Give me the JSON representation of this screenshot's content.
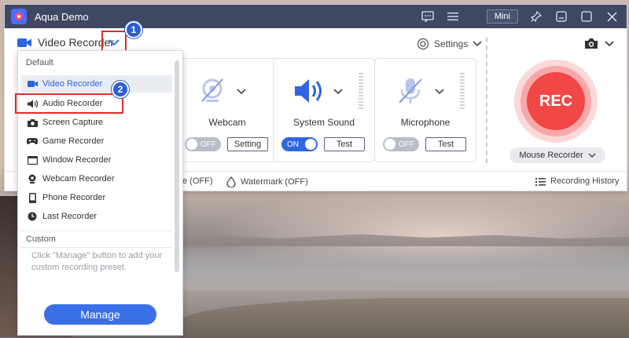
{
  "window": {
    "app_title": "Aqua Demo",
    "mini_label": "Mini"
  },
  "annotations": {
    "badge_1": "1",
    "badge_2": "2"
  },
  "mode": {
    "current_label": "Video Recorder"
  },
  "settings": {
    "label": "Settings"
  },
  "tiles": {
    "webcam": {
      "name": "Webcam",
      "toggle": "OFF",
      "button": "Setting"
    },
    "system_sound": {
      "name": "System Sound",
      "toggle": "ON",
      "button": "Test"
    },
    "microphone": {
      "name": "Microphone",
      "toggle": "OFF",
      "button": "Test"
    }
  },
  "rec": {
    "label": "REC",
    "mouse_recorder": "Mouse Recorder"
  },
  "bottom_bar": {
    "partial_label": "e (OFF)",
    "watermark": "Watermark (OFF)",
    "history": "Recording History"
  },
  "dropdown": {
    "default_heading": "Default",
    "items": [
      {
        "label": "Video Recorder",
        "icon": "video-camera-icon",
        "state": "selected"
      },
      {
        "label": "Audio Recorder",
        "icon": "speaker-icon",
        "state": "highlighted"
      },
      {
        "label": "Screen Capture",
        "icon": "camera-icon",
        "state": ""
      },
      {
        "label": "Game Recorder",
        "icon": "gamepad-icon",
        "state": ""
      },
      {
        "label": "Window Recorder",
        "icon": "window-icon",
        "state": ""
      },
      {
        "label": "Webcam Recorder",
        "icon": "webcam-icon",
        "state": ""
      },
      {
        "label": "Phone Recorder",
        "icon": "phone-icon",
        "state": ""
      },
      {
        "label": "Last Recorder",
        "icon": "clock-icon",
        "state": ""
      }
    ],
    "custom_heading": "Custom",
    "custom_desc": "Click \"Manage\" button to add your custom recording preset.",
    "manage_label": "Manage"
  },
  "colors": {
    "titlebar": "#3f4860",
    "accent": "#2f66e0",
    "rec": "#f24747",
    "highlight_box": "#e02a2a"
  }
}
